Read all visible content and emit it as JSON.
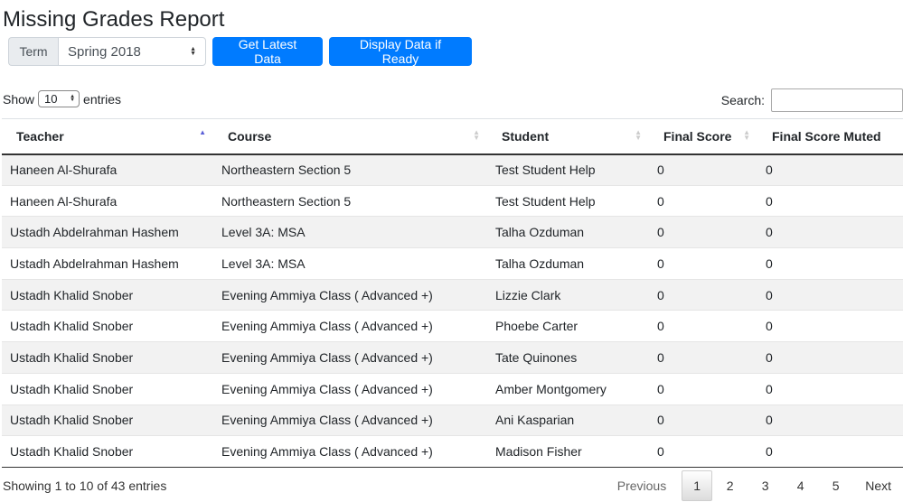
{
  "page": {
    "title": "Missing Grades Report"
  },
  "toolbar": {
    "term_label": "Term",
    "term_value": "Spring 2018",
    "get_latest_label": "Get Latest Data",
    "display_label": "Display Data if Ready"
  },
  "table_controls": {
    "show_label": "Show",
    "entries_value": "10",
    "entries_label": "entries",
    "search_label": "Search:"
  },
  "table": {
    "headers": [
      "Teacher",
      "Course",
      "Student",
      "Final Score",
      "Final Score Muted"
    ],
    "rows": [
      [
        "Haneen Al-Shurafa",
        "Northeastern Section 5",
        "Test Student Help",
        "0",
        "0"
      ],
      [
        "Haneen Al-Shurafa",
        "Northeastern Section 5",
        "Test Student Help",
        "0",
        "0"
      ],
      [
        "Ustadh Abdelrahman Hashem",
        "Level 3A: MSA",
        "Talha Ozduman",
        "0",
        "0"
      ],
      [
        "Ustadh Abdelrahman Hashem",
        "Level 3A: MSA",
        "Talha Ozduman",
        "0",
        "0"
      ],
      [
        "Ustadh Khalid Snober",
        "Evening Ammiya Class ( Advanced +)",
        "Lizzie Clark",
        "0",
        "0"
      ],
      [
        "Ustadh Khalid Snober",
        "Evening Ammiya Class ( Advanced +)",
        "Phoebe Carter",
        "0",
        "0"
      ],
      [
        "Ustadh Khalid Snober",
        "Evening Ammiya Class ( Advanced +)",
        "Tate Quinones",
        "0",
        "0"
      ],
      [
        "Ustadh Khalid Snober",
        "Evening Ammiya Class ( Advanced +)",
        "Amber Montgomery",
        "0",
        "0"
      ],
      [
        "Ustadh Khalid Snober",
        "Evening Ammiya Class ( Advanced +)",
        "Ani Kasparian",
        "0",
        "0"
      ],
      [
        "Ustadh Khalid Snober",
        "Evening Ammiya Class ( Advanced +)",
        "Madison Fisher",
        "0",
        "0"
      ]
    ]
  },
  "footer": {
    "info": "Showing 1 to 10 of 43 entries",
    "previous": "Previous",
    "pages": [
      "1",
      "2",
      "3",
      "4",
      "5"
    ],
    "next": "Next"
  }
}
